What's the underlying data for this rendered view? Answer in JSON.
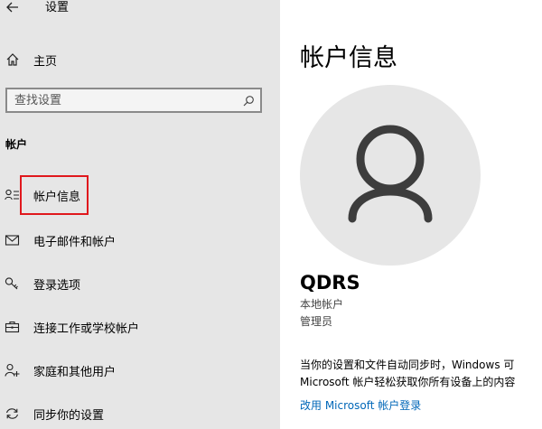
{
  "app": {
    "title": "设置"
  },
  "sidebar": {
    "home_label": "主页",
    "search_placeholder": "查找设置",
    "section_title": "帐户",
    "items": [
      {
        "label": "帐户信息",
        "icon": "account-info-icon"
      },
      {
        "label": "电子邮件和帐户",
        "icon": "email-icon"
      },
      {
        "label": "登录选项",
        "icon": "key-icon"
      },
      {
        "label": "连接工作或学校帐户",
        "icon": "briefcase-icon"
      },
      {
        "label": "家庭和其他用户",
        "icon": "add-person-icon"
      },
      {
        "label": "同步你的设置",
        "icon": "sync-icon"
      }
    ]
  },
  "main": {
    "page_title": "帐户信息",
    "user_name": "QDRS",
    "account_type": "本地帐户",
    "account_role": "管理员",
    "sync_text_line1": "当你的设置和文件自动同步时，Windows 可",
    "sync_text_line2": "Microsoft 帐户轻松获取你所有设备上的内容",
    "switch_link": "改用 Microsoft 帐户登录"
  },
  "colors": {
    "sidebar_bg": "#e6e6e6",
    "highlight": "#e0181d",
    "link": "#0067b8",
    "avatar_bg": "#e6e6e6",
    "avatar_fg": "#3d3d3d"
  }
}
